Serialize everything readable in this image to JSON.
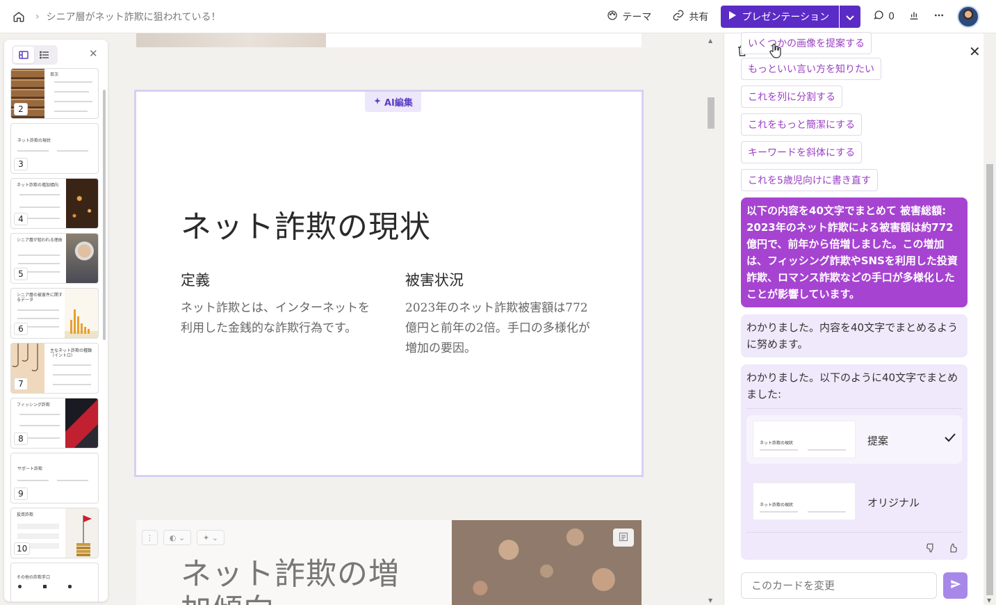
{
  "topbar": {
    "breadcrumb_title": "シニア層がネット詐欺に狙われている！",
    "theme_label": "テーマ",
    "share_label": "共有",
    "present_label": "プレゼンテーション",
    "comments_count": "0"
  },
  "sidebar": {
    "thumbnails": [
      {
        "num": "2",
        "title": "目次"
      },
      {
        "num": "3",
        "title": "ネット詐欺の現状"
      },
      {
        "num": "4",
        "title": "ネット詐欺の増加傾向"
      },
      {
        "num": "5",
        "title": "シニア層が狙われる理由"
      },
      {
        "num": "6",
        "title": "シニア層の被害件に関するデータ"
      },
      {
        "num": "7",
        "title": "主なネット詐欺の種類（イントロ）"
      },
      {
        "num": "8",
        "title": "フィッシング詐欺"
      },
      {
        "num": "9",
        "title": "サポート詐欺"
      },
      {
        "num": "10",
        "title": "投資詐欺"
      },
      {
        "num": "",
        "title": "その他の詐欺手口"
      }
    ]
  },
  "card": {
    "ai_tag": "AI編集",
    "title": "ネット詐欺の現状",
    "col1_heading": "定義",
    "col1_text": "ネット詐欺とは、インターネットを利用した金銭的な詐欺行為です。",
    "col2_heading": "被害状況",
    "col2_text": "2023年のネット詐欺被害額は772億円と前年の2倍。手口の多様化が増加の要因。"
  },
  "next_card": {
    "title": "ネット詐欺の増加傾向"
  },
  "ai_panel": {
    "suggestions": [
      "いくつかの画像を提案する",
      "もっといい言い方を知りたい",
      "これを列に分割する",
      "これをもっと簡潔にする",
      "キーワードを斜体にする",
      "これを5歳児向けに書き直す"
    ],
    "user_message": "以下の内容を40文字でまとめて 被害総額: 2023年のネット詐欺による被害額は約772億円で、前年から倍増しました。この増加は、フィッシング詐欺やSNSを利用した投資詐欺、ロマンス詐欺などの手口が多様化したことが影響しています。",
    "ai_reply_1": "わかりました。内容を40文字でまとめるように努めます。",
    "ai_reply_2": "わかりました。以下のように40文字でまとめました:",
    "option_proposal": "提案",
    "option_original": "オリジナル",
    "option_thumb_title": "ネット詐欺の現状",
    "input_placeholder": "このカードを変更"
  },
  "colors": {
    "accent": "#5b2bc6",
    "user_bubble": "#a644d1",
    "ai_bubble": "#efe9fb",
    "chip_text": "#9a3fc2"
  }
}
